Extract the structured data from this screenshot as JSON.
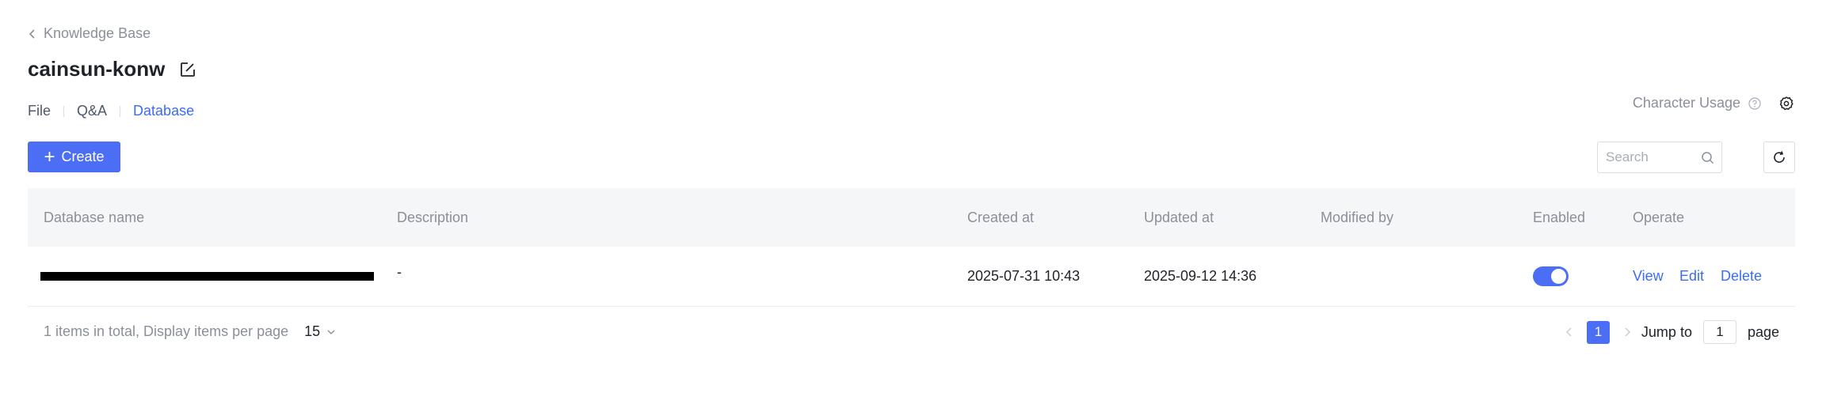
{
  "breadcrumb": {
    "back_label": "Knowledge Base"
  },
  "header": {
    "title": "cainsun-konw"
  },
  "tabs": [
    {
      "label": "File",
      "active": false
    },
    {
      "label": "Q&A",
      "active": false
    },
    {
      "label": "Database",
      "active": true
    }
  ],
  "usage": {
    "label": "Character Usage"
  },
  "toolbar": {
    "create_label": "Create",
    "search_placeholder": "Search"
  },
  "table": {
    "columns": [
      "Database name",
      "Description",
      "Created at",
      "Updated at",
      "Modified by",
      "Enabled",
      "Operate"
    ],
    "rows": [
      {
        "name": "[redacted]",
        "description": "-",
        "created_at": "2025-07-31 10:43",
        "updated_at": "2025-09-12 14:36",
        "modified_by": "",
        "enabled": true,
        "actions": [
          "View",
          "Edit",
          "Delete"
        ]
      }
    ]
  },
  "pagination": {
    "total_text": "1 items in total, Display items per page",
    "page_size": "15",
    "current_page": "1",
    "jump_label": "Jump to",
    "jump_value": "1",
    "page_label": "page"
  },
  "colors": {
    "accent": "#4c6ef5",
    "link": "#3b6cf6",
    "muted": "#8a8f99",
    "header_bg": "#f5f6f8"
  },
  "icons": [
    "chevron-left-icon",
    "edit-icon",
    "help-icon",
    "gear-icon",
    "plus-icon",
    "search-icon",
    "refresh-icon",
    "chevron-down-icon",
    "chevron-right-icon"
  ]
}
